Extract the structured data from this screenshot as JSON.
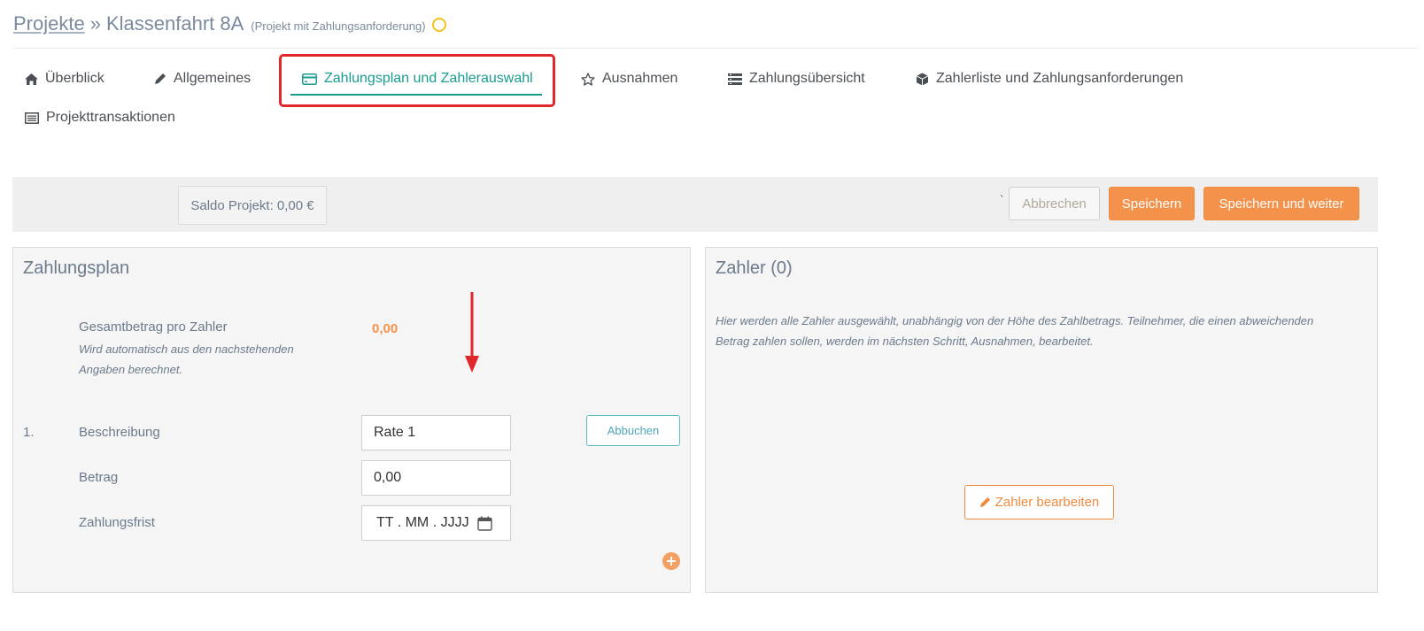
{
  "breadcrumb": {
    "parent": "Projekte",
    "separator": "»",
    "current": "Klassenfahrt 8A",
    "subtitle": "(Projekt mit Zahlungsanforderung)"
  },
  "tabs": [
    {
      "label": "Überblick",
      "icon": "home-icon",
      "active": false
    },
    {
      "label": "Allgemeines",
      "icon": "pencil-icon",
      "active": false
    },
    {
      "label": "Zahlungsplan und Zahlerauswahl",
      "icon": "credit-card-icon",
      "active": true
    },
    {
      "label": "Ausnahmen",
      "icon": "star-icon",
      "active": false
    },
    {
      "label": "Zahlungsübersicht",
      "icon": "list-icon",
      "active": false
    },
    {
      "label": "Zahlerliste und Zahlungsanforderungen",
      "icon": "cube-icon",
      "active": false
    },
    {
      "label": "Projekttransaktionen",
      "icon": "table-icon",
      "active": false
    }
  ],
  "toolbar": {
    "saldo": "Saldo Projekt: 0,00 €",
    "tick": "`",
    "cancel_label": "Abbrechen",
    "save_label": "Speichern",
    "save_next_label": "Speichern und weiter"
  },
  "zahlungsplan": {
    "title": "Zahlungsplan",
    "total_label": "Gesamtbetrag pro Zahler",
    "total_hint_line1": "Wird automatisch aus den nachstehenden",
    "total_hint_line2": "Angaben berechnet.",
    "total_value": "0,00",
    "rate": {
      "number": "1.",
      "description_label": "Beschreibung",
      "description_value": "Rate 1",
      "amount_label": "Betrag",
      "amount_value": "0,00",
      "due_label": "Zahlungsfrist",
      "due_placeholder": "TT . MM . JJJJ",
      "abbuchen_label": "Abbuchen"
    }
  },
  "zahler": {
    "title": "Zahler (0)",
    "info_line1": "Hier werden alle Zahler ausgewählt, unabhängig von der Höhe des Zahlbetrags. Teilnehmer, die einen abweichenden",
    "info_line2": "Betrag zahlen sollen, werden im nächsten Schritt, Ausnahmen, bearbeitet.",
    "edit_button": "Zahler bearbeiten"
  },
  "colors": {
    "accent_teal": "#1a9c8f",
    "orange": "#f4914a",
    "highlight_red": "#e0272c",
    "status_yellow": "#f2c31b"
  }
}
